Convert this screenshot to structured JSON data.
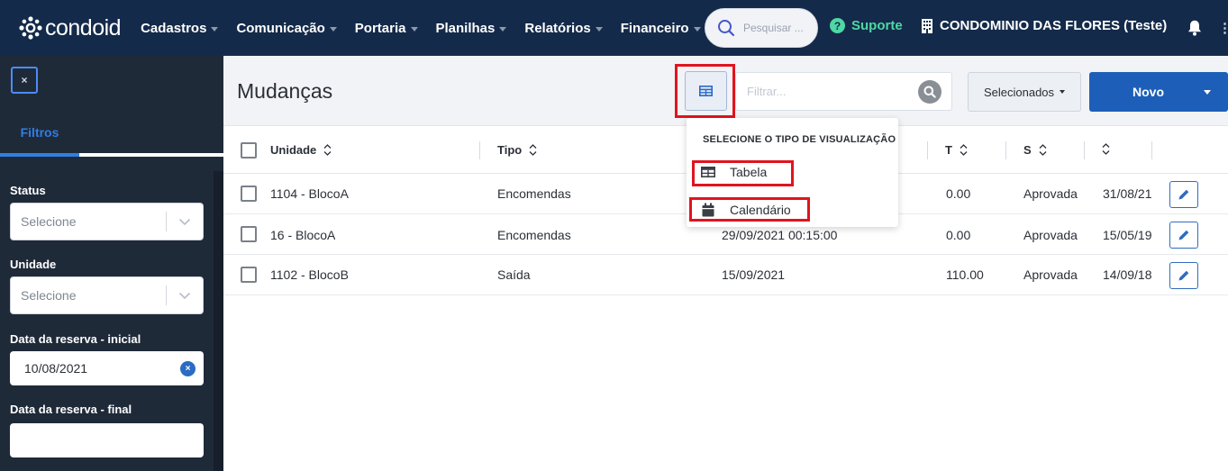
{
  "brand": {
    "name": "condoid"
  },
  "nav": {
    "items": [
      {
        "label": "Cadastros"
      },
      {
        "label": "Comunicação"
      },
      {
        "label": "Portaria"
      },
      {
        "label": "Planilhas"
      },
      {
        "label": "Relatórios"
      },
      {
        "label": "Financeiro"
      }
    ],
    "search_placeholder": "Pesquisar ...",
    "support_label": "Suporte",
    "condo_name": "CONDOMINIO DAS FLORES (Teste)",
    "more_glyph": "⋮"
  },
  "sidebar": {
    "close_glyph": "×",
    "tab_label": "Filtros",
    "fields": {
      "status_label": "Status",
      "status_value": "Selecione",
      "unidade_label": "Unidade",
      "unidade_value": "Selecione",
      "data_inicial_label": "Data da reserva - inicial",
      "data_inicial_value": "10/08/2021",
      "data_final_label": "Data da reserva - final",
      "data_final_value": ""
    }
  },
  "page": {
    "title": "Mudanças",
    "filter_placeholder": "Filtrar...",
    "selecionados_label": "Selecionados",
    "novo_label": "Novo"
  },
  "table": {
    "headers": {
      "unidade": "Unidade",
      "tipo": "Tipo",
      "t": "T",
      "s": "S"
    },
    "rows": [
      {
        "unidade": "1104 - BlocoA",
        "tipo": "Encomendas",
        "data": "",
        "valor": "0.00",
        "status": "Aprovada",
        "data2": "31/08/21"
      },
      {
        "unidade": "16 - BlocoA",
        "tipo": "Encomendas",
        "data": "29/09/2021 00:15:00",
        "valor": "0.00",
        "status": "Aprovada",
        "data2": "15/05/19"
      },
      {
        "unidade": "1102 - BlocoB",
        "tipo": "Saída",
        "data": "15/09/2021",
        "valor": "110.00",
        "status": "Aprovada",
        "data2": "14/09/18"
      }
    ]
  },
  "view_dropdown": {
    "header": "SELECIONE O TIPO DE VISUALIZAÇÃO",
    "options": [
      {
        "label": "Tabela",
        "icon": "table-icon"
      },
      {
        "label": "Calendário",
        "icon": "calendar-icon"
      }
    ]
  },
  "colors": {
    "topnav_bg": "#142a4a",
    "sidebar_bg": "#1f2a39",
    "accent_blue": "#1d5fb8",
    "support_green": "#4fd7a4",
    "highlight_red": "#e0141e"
  }
}
